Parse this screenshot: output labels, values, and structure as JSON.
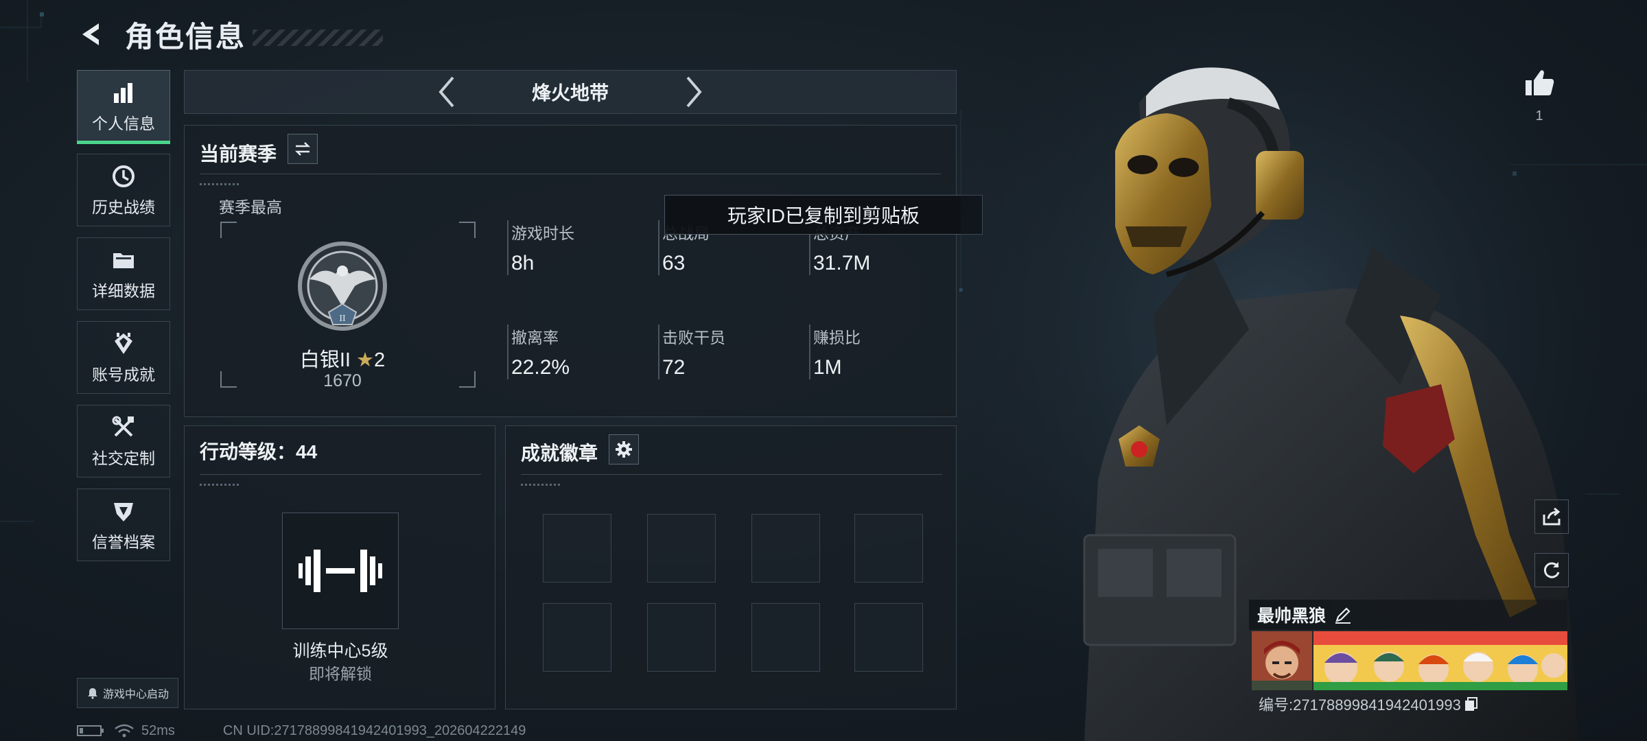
{
  "header": {
    "title": "角色信息"
  },
  "sidebar": {
    "items": [
      {
        "label": "个人信息",
        "icon": "bar-chart-icon",
        "active": true
      },
      {
        "label": "历史战绩",
        "icon": "history-icon"
      },
      {
        "label": "详细数据",
        "icon": "folder-icon"
      },
      {
        "label": "账号成就",
        "icon": "achievement-icon"
      },
      {
        "label": "社交定制",
        "icon": "tools-icon"
      },
      {
        "label": "信誉档案",
        "icon": "shield-icon"
      }
    ],
    "launch_label": "游戏中心启动"
  },
  "mode": {
    "label": "烽火地带"
  },
  "season": {
    "title": "当前赛季",
    "best_label": "赛季最高",
    "rank_name": "白银II",
    "rank_stars": "2",
    "rank_points": "1670",
    "badge_numeral": "II",
    "stats": [
      {
        "label": "游戏时长",
        "value": "8h"
      },
      {
        "label": "总战局",
        "value": "63"
      },
      {
        "label": "总资产",
        "value": "31.7M"
      },
      {
        "label": "撤离率",
        "value": "22.2%"
      },
      {
        "label": "击败干员",
        "value": "72"
      },
      {
        "label": "赚损比",
        "value": "1M"
      }
    ]
  },
  "action_level": {
    "title": "行动等级：44",
    "training_label": "训练中心5级",
    "unlock_text": "即将解锁"
  },
  "achievements": {
    "title": "成就徽章"
  },
  "toast": {
    "text": "玩家ID已复制到剪贴板"
  },
  "status": {
    "ping": "52ms",
    "uid": "CN UID:27178899841942401993_202604222149"
  },
  "player": {
    "likes": "1",
    "name": "最帅黑狼",
    "id_text": "编号:27178899841942401993"
  },
  "colors": {
    "accent": "#4bd58a",
    "gold": "#b8953e"
  }
}
